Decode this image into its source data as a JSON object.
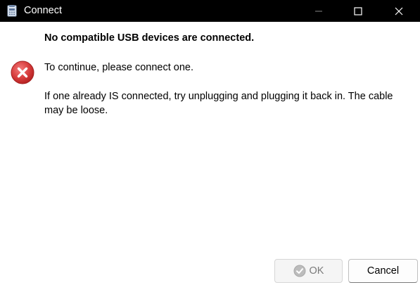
{
  "window": {
    "title": "Connect",
    "title_bar_color": "#000000"
  },
  "icons": {
    "app": "clipboard-calculator-icon",
    "error": "error-x-icon",
    "ok": "check-circle-icon"
  },
  "message": {
    "heading": "No compatible USB devices are connected.",
    "line1": "To continue, please connect one.",
    "line2": "If one already IS connected, try unplugging and plugging it back in. The cable may be loose."
  },
  "buttons": {
    "ok_label": "OK",
    "cancel_label": "Cancel"
  },
  "colors": {
    "error_red": "#d32f2f",
    "ok_disabled_text": "#7a7a7a"
  }
}
